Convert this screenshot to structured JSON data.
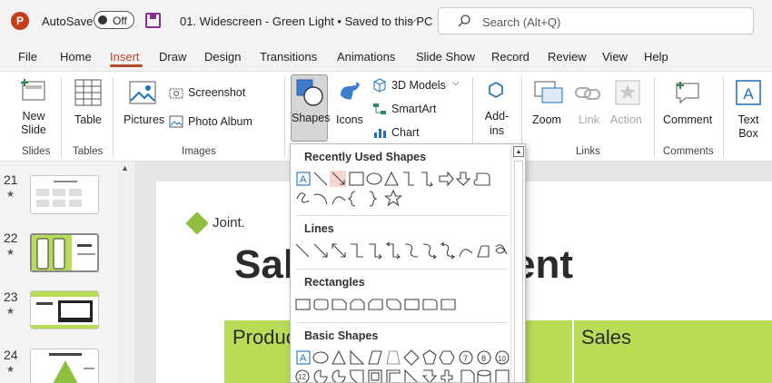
{
  "app": {
    "logo_letter": "P",
    "autosave_label": "AutoSave",
    "autosave_state": "Off",
    "doc_title": "01. Widescreen - Green Light • Saved to this PC",
    "search_placeholder": "Search (Alt+Q)"
  },
  "tabs": [
    "File",
    "Home",
    "Insert",
    "Draw",
    "Design",
    "Transitions",
    "Animations",
    "Slide Show",
    "Record",
    "Review",
    "View",
    "Help"
  ],
  "active_tab": "Insert",
  "ribbon": {
    "new_slide": "New Slide",
    "table": "Table",
    "pictures": "Pictures",
    "screenshot": "Screenshot",
    "photo_album": "Photo Album",
    "shapes": "Shapes",
    "icons": "Icons",
    "models_3d": "3D Models",
    "smartart": "SmartArt",
    "chart": "Chart",
    "addins": "Add-ins",
    "zoom": "Zoom",
    "link": "Link",
    "action": "Action",
    "comment": "Comment",
    "textbox": "Text Box",
    "groups": {
      "slides": "Slides",
      "tables": "Tables",
      "images": "Images",
      "links": "Links",
      "comments": "Comments"
    }
  },
  "slides_panel": [
    {
      "number": "21",
      "star": "★"
    },
    {
      "number": "22",
      "star": "★"
    },
    {
      "number": "23",
      "star": "★"
    },
    {
      "number": "24",
      "star": "★"
    }
  ],
  "slide": {
    "brand": "Joint.",
    "title_left": "Sal",
    "title_right": "ent",
    "header_product": "Produc",
    "header_sales": "Sales"
  },
  "shapes_menu": {
    "recently_used": "Recently Used Shapes",
    "lines": "Lines",
    "rectangles": "Rectangles",
    "basic_shapes": "Basic Shapes"
  },
  "colors": {
    "accent": "#b7472a",
    "slide_green": "#b8dc56",
    "ppt_brand": "#c43e1c"
  }
}
